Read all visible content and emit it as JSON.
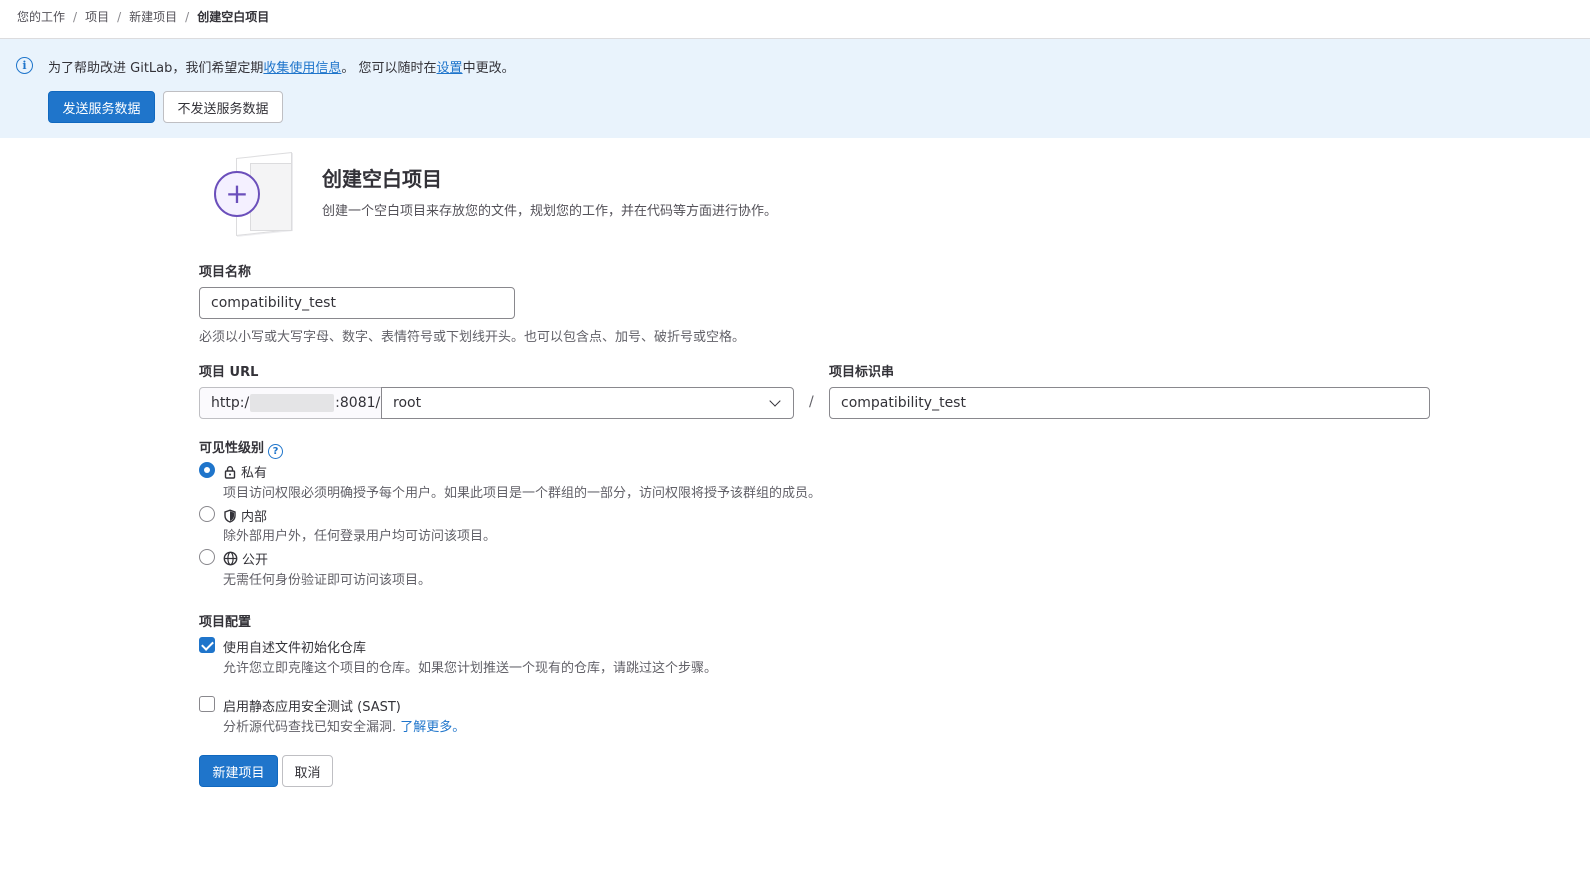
{
  "breadcrumb": {
    "items": [
      "您的工作",
      "项目",
      "新建项目"
    ],
    "current": "创建空白项目",
    "separator": "/"
  },
  "banner": {
    "text_before": "为了帮助改进 GitLab，我们希望定期",
    "collect_link": "收集使用信息",
    "text_middle": "。 您可以随时在",
    "settings_link": "设置",
    "text_after": "中更改。",
    "send_button": "发送服务数据",
    "dont_send_button": "不发送服务数据"
  },
  "hero": {
    "title": "创建空白项目",
    "description": "创建一个空白项目来存放您的文件，规划您的工作，并在代码等方面进行协作。"
  },
  "project_name": {
    "label": "项目名称",
    "value": "compatibility_test",
    "help": "必须以小写或大写字母、数字、表情符号或下划线开头。也可以包含点、加号、破折号或空格。"
  },
  "project_url": {
    "label": "项目 URL",
    "prefix_start": "http:/",
    "prefix_end": ":8081/",
    "namespace": "root",
    "separator": "/"
  },
  "project_slug": {
    "label": "项目标识串",
    "value": "compatibility_test"
  },
  "visibility": {
    "label": "可见性级别",
    "help_icon": "?",
    "options": [
      {
        "title": "私有",
        "description": "项目访问权限必须明确授予每个用户。如果此项目是一个群组的一部分，访问权限将授予该群组的成员。",
        "selected": true,
        "icon": "lock-icon"
      },
      {
        "title": "内部",
        "description": "除外部用户外，任何登录用户均可访问该项目。",
        "selected": false,
        "icon": "shield-icon"
      },
      {
        "title": "公开",
        "description": "无需任何身份验证即可访问该项目。",
        "selected": false,
        "icon": "globe-icon"
      }
    ]
  },
  "config": {
    "label": "项目配置",
    "readme": {
      "title": "使用自述文件初始化仓库",
      "description": "允许您立即克隆这个项目的仓库。如果您计划推送一个现有的仓库，请跳过这个步骤。",
      "checked": true
    },
    "sast": {
      "title": "启用静态应用安全测试 (SAST)",
      "description": "分析源代码查找已知安全漏洞.",
      "learn_more": "了解更多。",
      "checked": false
    }
  },
  "actions": {
    "create": "新建项目",
    "cancel": "取消"
  },
  "colors": {
    "primary": "#1f75cb",
    "banner_bg": "#e9f3fc",
    "accent_purple": "#6b4fbb"
  }
}
